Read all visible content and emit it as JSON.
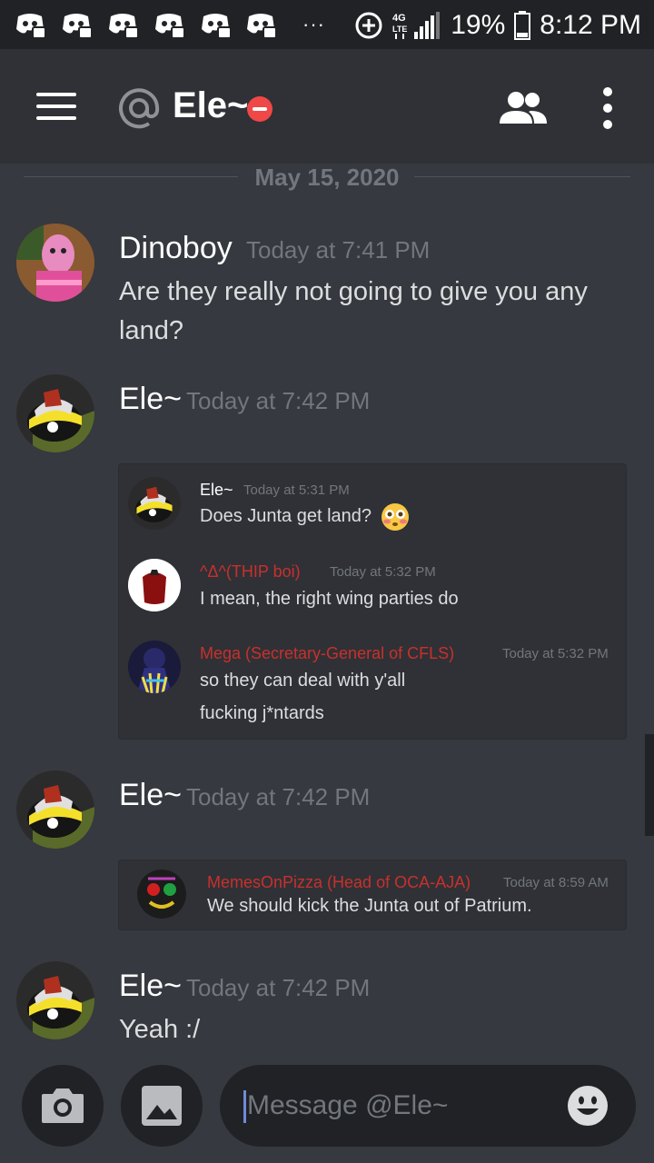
{
  "status_bar": {
    "battery_percent": "19%",
    "time": "8:12 PM",
    "overflow": "···",
    "network": "4G LTE",
    "app_notification_icons": [
      "discord-notification-icon",
      "discord-notification-icon",
      "discord-notification-icon",
      "discord-notification-icon",
      "discord-notification-icon",
      "discord-notification-icon"
    ]
  },
  "toolbar": {
    "channel_name": "Ele~",
    "status": "do-not-disturb",
    "icons": [
      "menu-icon",
      "at-icon",
      "members-icon",
      "more-vertical-icon"
    ]
  },
  "date_divider": "May 15, 2020",
  "messages": [
    {
      "author": "Dinoboy",
      "timestamp": "Today at 7:41 PM",
      "lines": [
        "Are they really not going to give you any",
        "land?"
      ]
    },
    {
      "author": "Ele~",
      "timestamp": "Today at 7:42 PM",
      "quoted": [
        {
          "author": "Ele~",
          "author_color": "#ffffff",
          "timestamp": "Today at 5:31 PM",
          "lines": [
            "Does Junta get land?"
          ]
        },
        {
          "author": "^Δ^(THIP boi)",
          "author_color": "#c9302c",
          "timestamp": "Today at 5:32 PM",
          "lines": [
            "I mean, the right wing parties do"
          ]
        },
        {
          "author": "Mega (Secretary-General of CFLS)",
          "author_color": "#c9302c",
          "timestamp": "Today at 5:32 PM",
          "lines": [
            "so they can deal with y'all",
            "fucking j*ntards"
          ]
        }
      ]
    },
    {
      "author": "Ele~",
      "timestamp": "Today at 7:42 PM",
      "quoted": [
        {
          "author": "MemesOnPizza (Head of OCA-AJA)",
          "author_color": "#c9302c",
          "timestamp": "Today at 8:59 AM",
          "lines": [
            "We should kick the Junta out of Patrium."
          ]
        }
      ]
    },
    {
      "author": "Ele~",
      "timestamp": "Today at 7:42 PM",
      "lines": [
        "Yeah :/"
      ]
    }
  ],
  "composer": {
    "placeholder": "Message @Ele~",
    "icons": [
      "camera-icon",
      "image-icon",
      "emoji-icon"
    ]
  },
  "colors": {
    "background": "#36393f",
    "toolbar": "#2f3136",
    "status_bar": "#202225",
    "muted_text": "#72767d",
    "dnd_red": "#f04747",
    "accent": "#7289da"
  }
}
